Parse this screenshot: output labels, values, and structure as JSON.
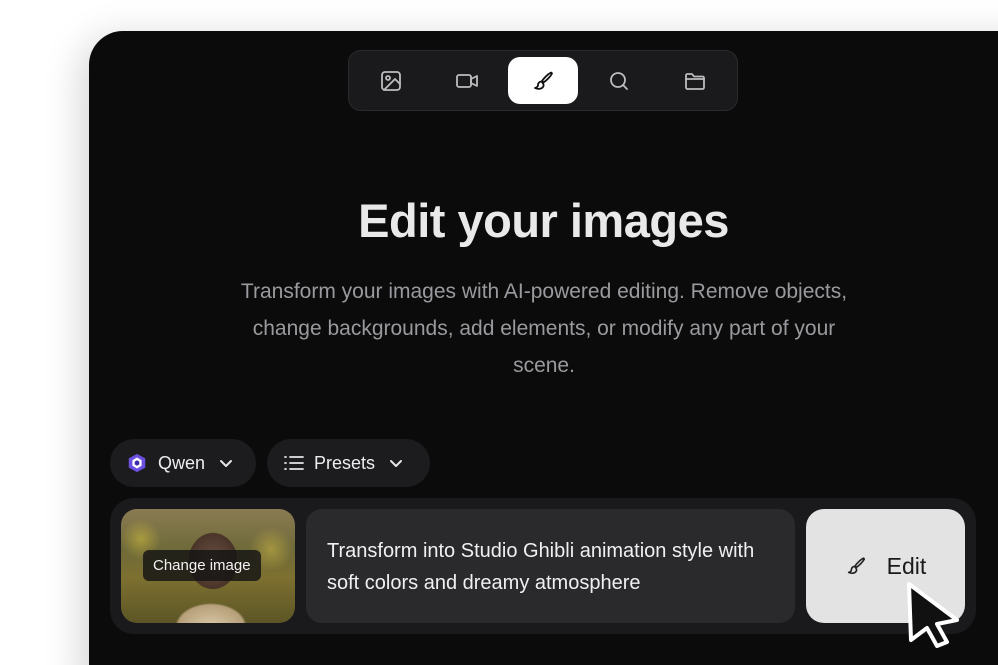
{
  "toolbar": {
    "modes": [
      {
        "name": "image-mode",
        "icon": "image-icon",
        "active": false
      },
      {
        "name": "video-mode",
        "icon": "video-camera-icon",
        "active": false
      },
      {
        "name": "edit-mode",
        "icon": "brush-icon",
        "active": true
      },
      {
        "name": "search-mode",
        "icon": "search-icon",
        "active": false
      },
      {
        "name": "folder-mode",
        "icon": "folder-icon",
        "active": false
      }
    ]
  },
  "hero": {
    "title": "Edit your images",
    "subtitle": "Transform your images with AI-powered editing. Remove objects, change backgrounds, add elements, or modify any part of your scene."
  },
  "controls": {
    "model_label": "Qwen",
    "presets_label": "Presets"
  },
  "composer": {
    "change_image_label": "Change image",
    "prompt_text": "Transform into Studio Ghibli animation style with soft colors and dreamy atmosphere",
    "edit_label": "Edit"
  },
  "colors": {
    "background": "#0b0b0c",
    "panel": "#1a1a1c",
    "active_mode": "#ffffff",
    "edit_button": "#e3e3e3",
    "qwen_brand": "#6b4fe0"
  }
}
